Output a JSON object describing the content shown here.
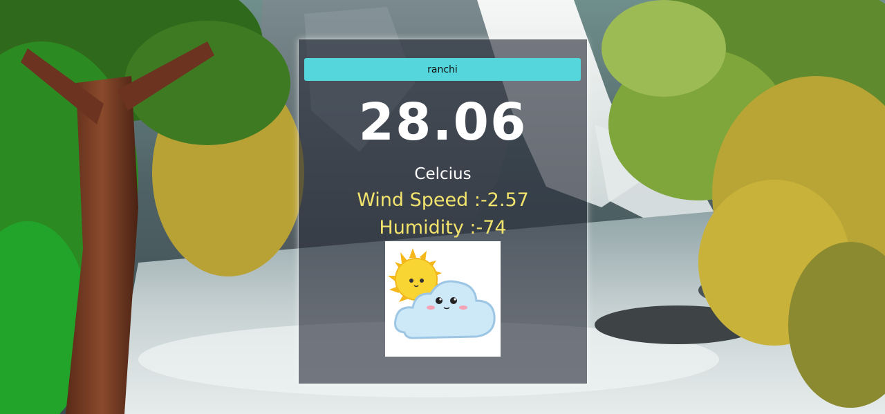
{
  "weather": {
    "city_value": "ranchi",
    "temperature": "28.06",
    "unit": "Celcius",
    "wind_speed": "Wind Speed :-2.57",
    "humidity": "Humidity :-74",
    "icon": "sun-cloud-icon"
  },
  "colors": {
    "input_bg": "#55d6dc",
    "info_text": "#f2e36c",
    "temp_text": "#ffffff"
  }
}
